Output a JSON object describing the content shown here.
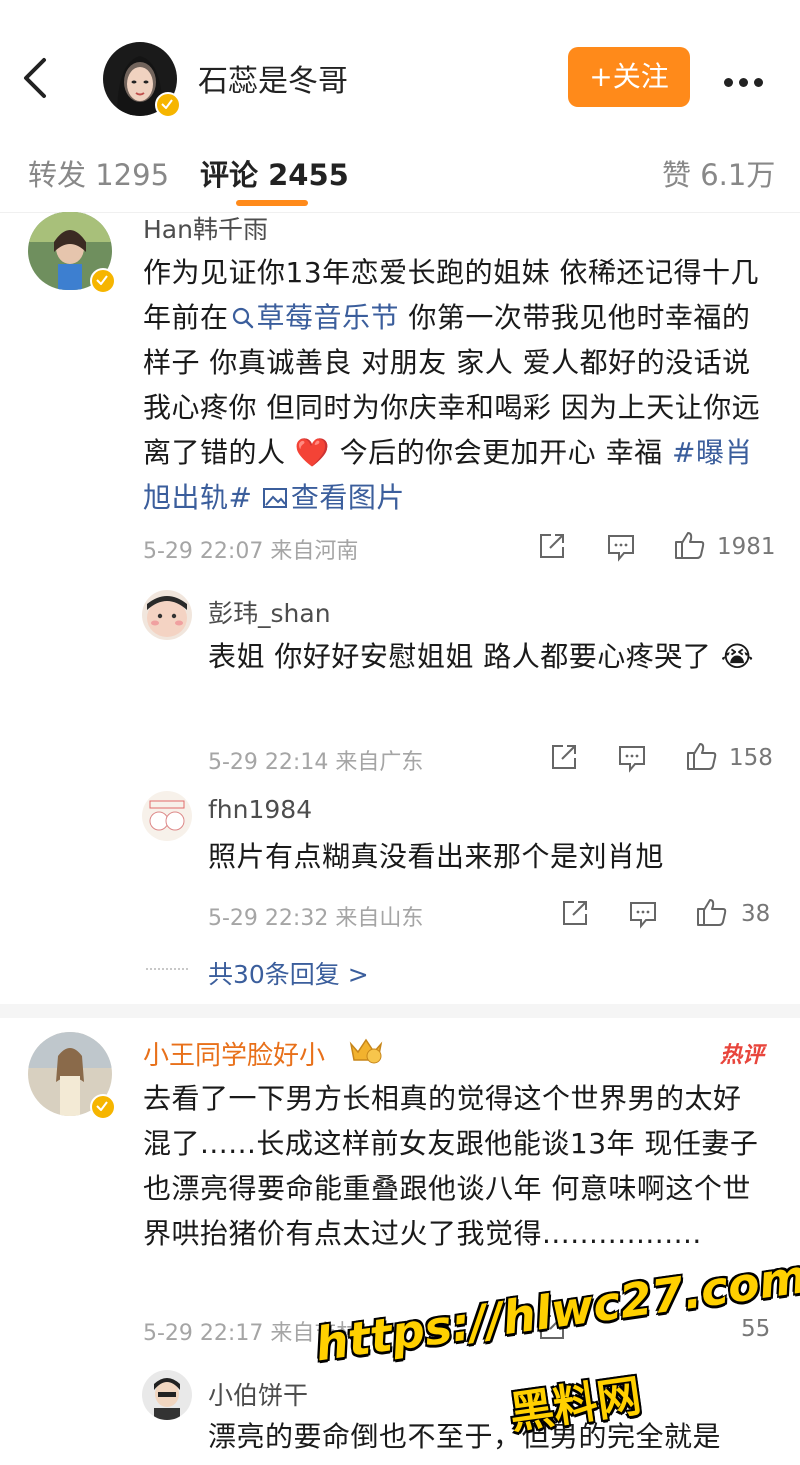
{
  "header": {
    "name": "石蕊是冬哥",
    "follow_label": "+关注"
  },
  "tabs": {
    "repost": "转发 1295",
    "comments": "评论 2455",
    "likes": "赞 6.1万"
  },
  "comments": [
    {
      "name": "Han韩千雨",
      "text_parts": {
        "p1": "作为见证你13年恋爱长跑的姐妹  依稀还记得十几年前在",
        "link1": "草莓音乐节",
        "p2": " 你第一次带我见他时幸福的样子  你真诚善良 对朋友 家人 爱人都好的没话说 我心疼你 但同时为你庆幸和喝彩 因为上天让你远离了错的人 ",
        "heart": "❤️",
        "p3": " 今后的你会更加开心 幸福 ",
        "tag": "#曝肖旭出轨#",
        "view_image": "查看图片"
      },
      "meta": "5-29 22:07 来自河南",
      "likes": "1981"
    },
    {
      "name": "小王同学脸好小",
      "hot_label": "热评",
      "text": "去看了一下男方长相真的觉得这个世界男的太好混了......长成这样前女友跟他能谈13年 现任妻子也漂亮得要命能重叠跟他谈八年 何意味啊这个世界哄抬猪价有点太过火了我觉得.................",
      "meta": "5-29 22:17 来自吉林",
      "likes": "55"
    }
  ],
  "replies": [
    {
      "name": "彭玮_shan",
      "text": "表姐 你好好安慰姐姐 路人都要心疼哭了",
      "emoji": "😭",
      "meta": "5-29 22:14 来自广东",
      "likes": "158"
    },
    {
      "name": "fhn1984",
      "text": "照片有点糊真没看出来那个是刘肖旭",
      "meta": "5-29 22:32 来自山东",
      "likes": "38"
    },
    {
      "name": "小伯饼干",
      "text": "漂亮的要命倒也不至于，但男的完全就是"
    }
  ],
  "more_replies": "共30条回复 >",
  "watermark": {
    "url": "https://hlwc27.com",
    "site": "黑料网"
  }
}
